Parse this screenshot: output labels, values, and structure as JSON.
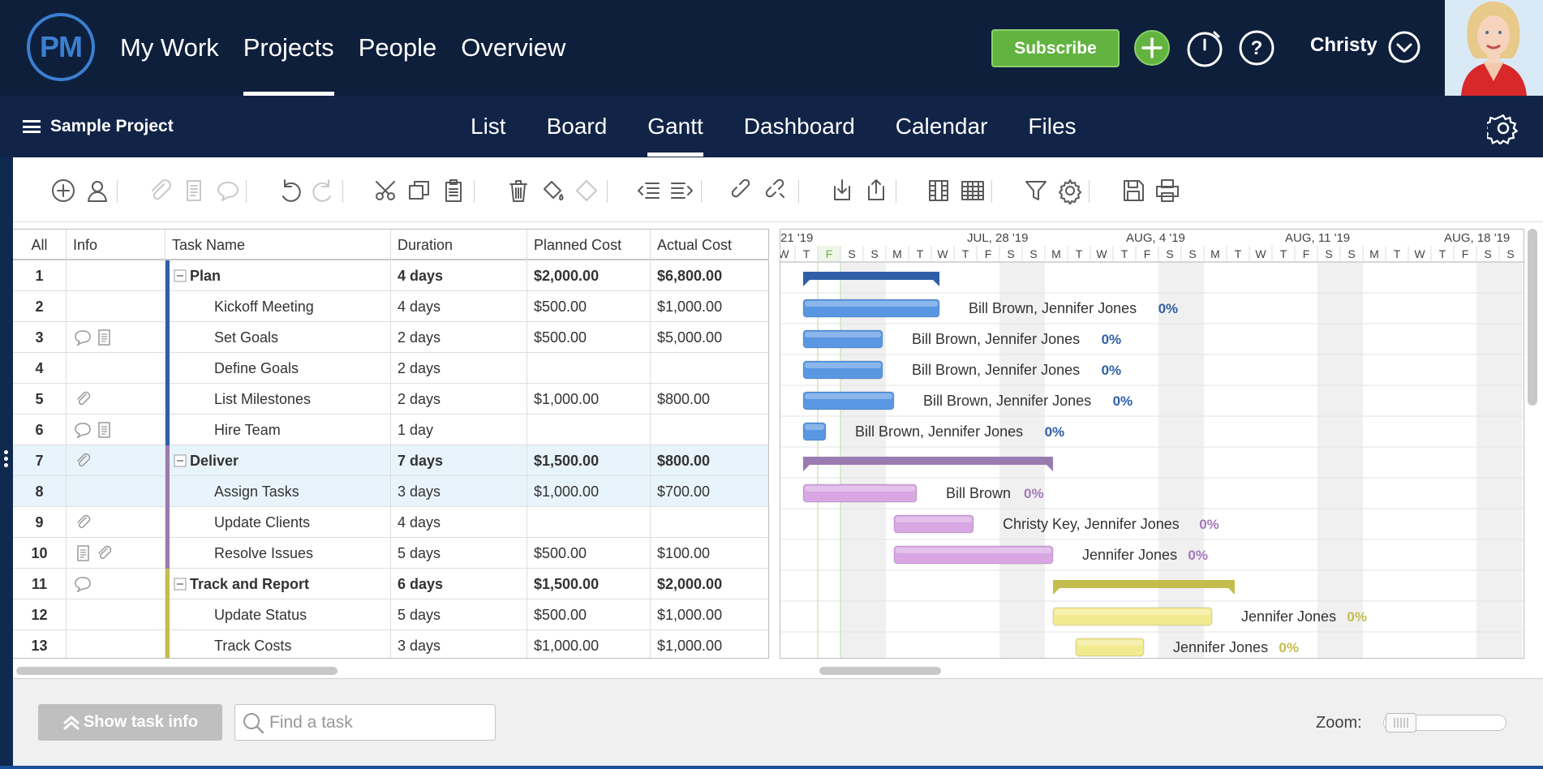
{
  "app": {
    "logo_text": "PM"
  },
  "topnav": [
    {
      "label": "My Work",
      "active": false
    },
    {
      "label": "Projects",
      "active": true
    },
    {
      "label": "People",
      "active": false
    },
    {
      "label": "Overview",
      "active": false
    }
  ],
  "header": {
    "subscribe_label": "Subscribe",
    "user_name": "Christy"
  },
  "project": {
    "name": "Sample Project"
  },
  "tabs": [
    {
      "label": "List",
      "active": false
    },
    {
      "label": "Board",
      "active": false
    },
    {
      "label": "Gantt",
      "active": true
    },
    {
      "label": "Dashboard",
      "active": false
    },
    {
      "label": "Calendar",
      "active": false
    },
    {
      "label": "Files",
      "active": false
    }
  ],
  "toolbar_icons": [
    "add-task-icon",
    "assign-user-icon",
    "attach-icon",
    "note-icon",
    "comment-icon",
    "undo-icon",
    "redo-icon",
    "cut-icon",
    "copy-icon",
    "paste-icon",
    "delete-icon",
    "fill-color-icon",
    "clear-format-icon",
    "outdent-icon",
    "indent-icon",
    "link-icon",
    "unlink-icon",
    "import-icon",
    "export-icon",
    "columns-icon",
    "grid-icon",
    "filter-icon",
    "settings-icon",
    "save-icon",
    "print-icon"
  ],
  "grid": {
    "columns": [
      "All",
      "Info",
      "Task Name",
      "Duration",
      "Planned Cost",
      "Actual Cost"
    ],
    "rows": [
      {
        "id": "1",
        "info": [],
        "name": "Plan",
        "duration": "4 days",
        "planned": "$2,000.00",
        "actual": "$6,800.00",
        "summary": true,
        "color": "#2f5fa8"
      },
      {
        "id": "2",
        "info": [],
        "name": "Kickoff Meeting",
        "duration": "4 days",
        "planned": "$500.00",
        "actual": "$1,000.00",
        "summary": false,
        "color": "#2f5fa8"
      },
      {
        "id": "3",
        "info": [
          "comment",
          "note"
        ],
        "name": "Set Goals",
        "duration": "2 days",
        "planned": "$500.00",
        "actual": "$5,000.00",
        "summary": false,
        "color": "#2f5fa8"
      },
      {
        "id": "4",
        "info": [],
        "name": "Define Goals",
        "duration": "2 days",
        "planned": "",
        "actual": "",
        "summary": false,
        "color": "#2f5fa8"
      },
      {
        "id": "5",
        "info": [
          "attach"
        ],
        "name": "List Milestones",
        "duration": "2 days",
        "planned": "$1,000.00",
        "actual": "$800.00",
        "summary": false,
        "color": "#2f5fa8"
      },
      {
        "id": "6",
        "info": [
          "comment",
          "note"
        ],
        "name": "Hire Team",
        "duration": "1 day",
        "planned": "",
        "actual": "",
        "summary": false,
        "color": "#2f5fa8"
      },
      {
        "id": "7",
        "info": [
          "attach"
        ],
        "name": "Deliver",
        "duration": "7 days",
        "planned": "$1,500.00",
        "actual": "$800.00",
        "summary": true,
        "color": "#9a7bb0",
        "selected": true
      },
      {
        "id": "8",
        "info": [],
        "name": "Assign Tasks",
        "duration": "3 days",
        "planned": "$1,000.00",
        "actual": "$700.00",
        "summary": false,
        "color": "#9a7bb0",
        "selected": true
      },
      {
        "id": "9",
        "info": [
          "attach"
        ],
        "name": "Update Clients",
        "duration": "4 days",
        "planned": "",
        "actual": "",
        "summary": false,
        "color": "#9a7bb0"
      },
      {
        "id": "10",
        "info": [
          "note",
          "attach"
        ],
        "name": "Resolve Issues",
        "duration": "5 days",
        "planned": "$500.00",
        "actual": "$100.00",
        "summary": false,
        "color": "#9a7bb0"
      },
      {
        "id": "11",
        "info": [
          "comment"
        ],
        "name": "Track and Report",
        "duration": "6 days",
        "planned": "$1,500.00",
        "actual": "$2,000.00",
        "summary": true,
        "color": "#c4bd4e"
      },
      {
        "id": "12",
        "info": [],
        "name": "Update Status",
        "duration": "5 days",
        "planned": "$500.00",
        "actual": "$1,000.00",
        "summary": false,
        "color": "#c4bd4e"
      },
      {
        "id": "13",
        "info": [],
        "name": "Track Costs",
        "duration": "3 days",
        "planned": "$1,000.00",
        "actual": "$1,000.00",
        "summary": false,
        "color": "#c4bd4e"
      }
    ]
  },
  "gantt": {
    "week_labels": [
      "21 '19",
      "JUL, 28 '19",
      "AUG, 4 '19",
      "AUG, 11 '19",
      "AUG, 18 '19"
    ],
    "day_letters": [
      "W",
      "T",
      "F",
      "S",
      "S",
      "M",
      "T",
      "W",
      "T",
      "F",
      "S",
      "S",
      "M",
      "T",
      "W",
      "T",
      "F",
      "S",
      "S",
      "M",
      "T",
      "W",
      "T",
      "F",
      "S",
      "S",
      "M",
      "T",
      "W",
      "T",
      "F",
      "S",
      "S"
    ],
    "today_index": 2,
    "bars": [
      {
        "row": 0,
        "type": "summary",
        "start": 1.5,
        "days": 6,
        "color": "#2f5fa8",
        "label": "",
        "pct": ""
      },
      {
        "row": 1,
        "type": "task",
        "start": 1.5,
        "days": 6,
        "color": "#5a97e3",
        "label": "Bill Brown, Jennifer Jones",
        "pct": "0%",
        "pct_color": "#2f5fa8"
      },
      {
        "row": 2,
        "type": "task",
        "start": 1.5,
        "days": 3.5,
        "color": "#5a97e3",
        "label": "Bill Brown, Jennifer Jones",
        "pct": "0%",
        "pct_color": "#2f5fa8"
      },
      {
        "row": 3,
        "type": "task",
        "start": 1.5,
        "days": 3.5,
        "color": "#5a97e3",
        "label": "Bill Brown, Jennifer Jones",
        "pct": "0%",
        "pct_color": "#2f5fa8"
      },
      {
        "row": 4,
        "type": "task",
        "start": 1.5,
        "days": 4,
        "color": "#5a97e3",
        "label": "Bill Brown, Jennifer Jones",
        "pct": "0%",
        "pct_color": "#2f5fa8"
      },
      {
        "row": 5,
        "type": "task",
        "start": 1.5,
        "days": 1,
        "color": "#5a97e3",
        "label": "Bill Brown, Jennifer Jones",
        "pct": "0%",
        "pct_color": "#2f5fa8"
      },
      {
        "row": 6,
        "type": "summary",
        "start": 1.5,
        "days": 11,
        "color": "#9a7bb0",
        "label": "",
        "pct": ""
      },
      {
        "row": 7,
        "type": "task",
        "start": 1.5,
        "days": 5,
        "color": "#d7a6e3",
        "label": "Bill Brown",
        "pct": "0%",
        "pct_color": "#a579b8"
      },
      {
        "row": 8,
        "type": "task",
        "start": 5.5,
        "days": 3.5,
        "color": "#d7a6e3",
        "label": "Christy Key, Jennifer Jones",
        "pct": "0%",
        "pct_color": "#a579b8"
      },
      {
        "row": 9,
        "type": "task",
        "start": 5.5,
        "days": 7,
        "color": "#d7a6e3",
        "label": "Jennifer Jones",
        "pct": "0%",
        "pct_color": "#a579b8"
      },
      {
        "row": 10,
        "type": "summary",
        "start": 12.5,
        "days": 8,
        "color": "#c4bd4e",
        "label": "",
        "pct": ""
      },
      {
        "row": 11,
        "type": "task",
        "start": 12.5,
        "days": 7,
        "color": "#f2ea8e",
        "label": "Jennifer Jones",
        "pct": "0%",
        "pct_color": "#c4bd4e"
      },
      {
        "row": 12,
        "type": "task",
        "start": 13.5,
        "days": 3,
        "color": "#f2ea8e",
        "label": "Jennifer Jones",
        "pct": "0%",
        "pct_color": "#c4bd4e"
      }
    ]
  },
  "bottom": {
    "show_task_info": "Show task info",
    "search_placeholder": "Find a task",
    "zoom_label": "Zoom:"
  }
}
